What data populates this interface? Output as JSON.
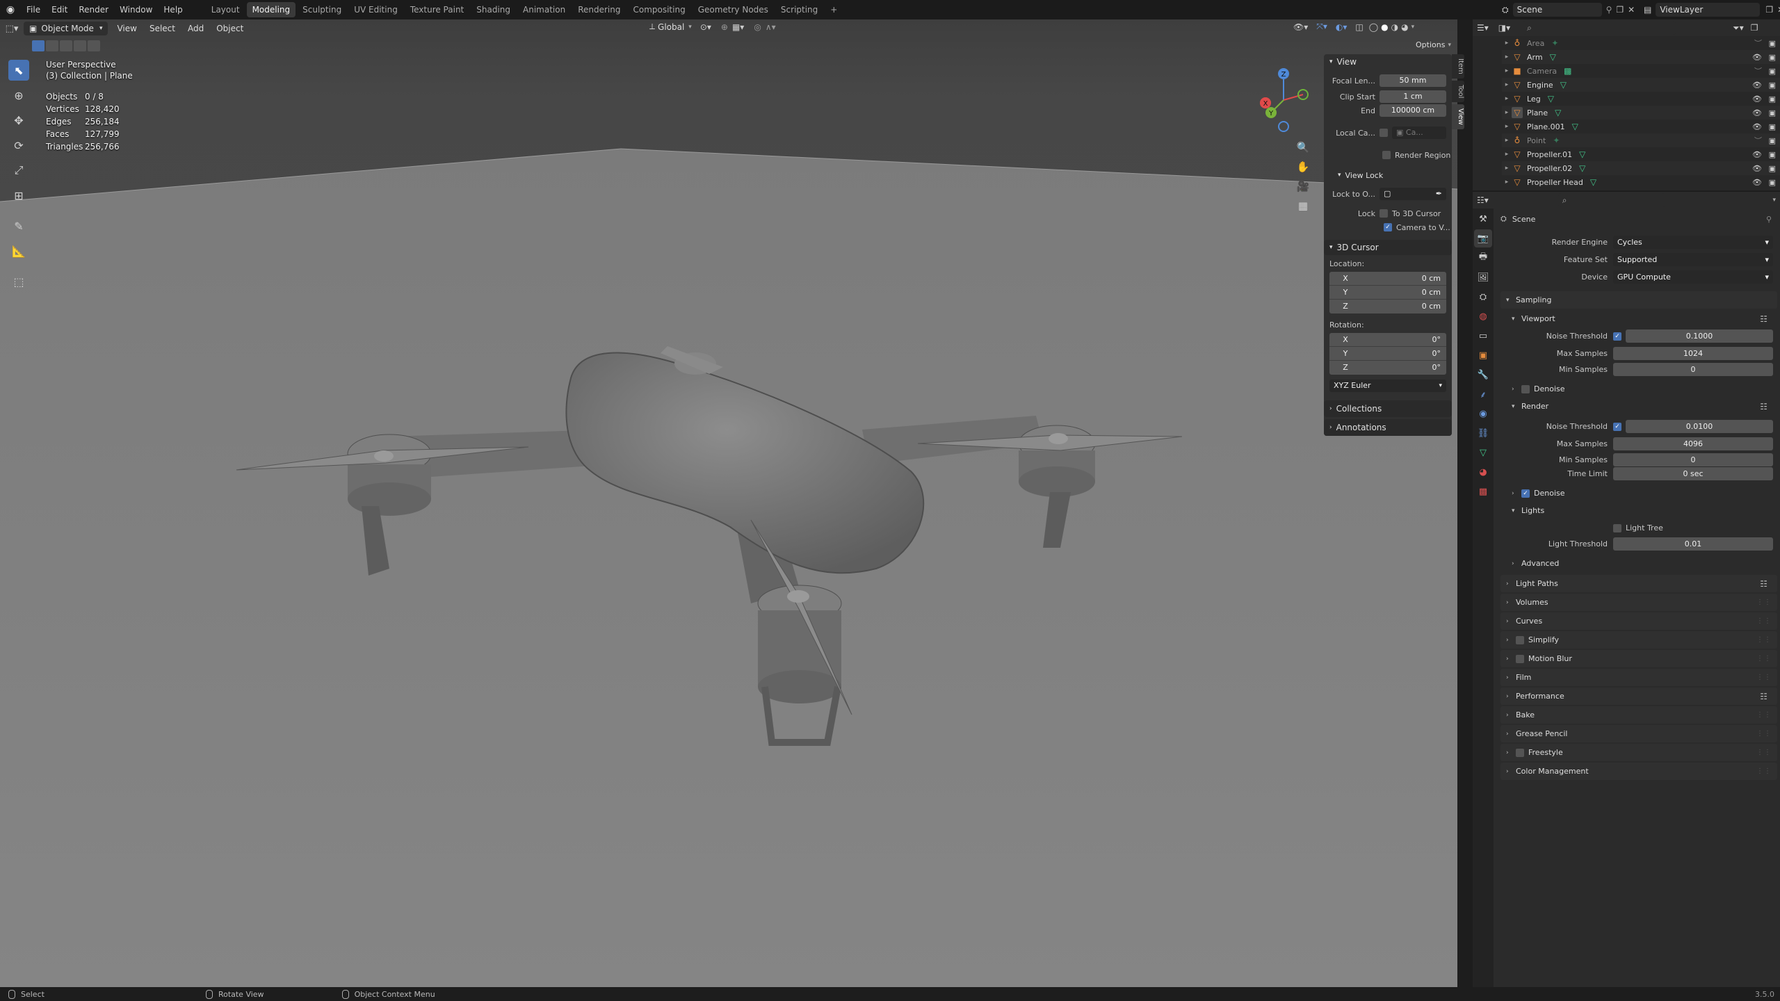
{
  "topbar": {
    "menus": [
      "File",
      "Edit",
      "Render",
      "Window",
      "Help"
    ],
    "workspaces": [
      "Layout",
      "Modeling",
      "Sculpting",
      "UV Editing",
      "Texture Paint",
      "Shading",
      "Animation",
      "Rendering",
      "Compositing",
      "Geometry Nodes",
      "Scripting"
    ],
    "active_workspace": "Modeling",
    "add_tab": "+",
    "scene_name": "Scene",
    "view_layer": "ViewLayer"
  },
  "viewport_header": {
    "mode": "Object Mode",
    "menus": [
      "View",
      "Select",
      "Add",
      "Object"
    ],
    "orientation": "Global",
    "options_label": "Options"
  },
  "viewport": {
    "view_name": "User Perspective",
    "collection": "(3) Collection | Plane",
    "stats": [
      {
        "label": "Objects",
        "value": "0 / 8"
      },
      {
        "label": "Vertices",
        "value": "128,420"
      },
      {
        "label": "Edges",
        "value": "256,184"
      },
      {
        "label": "Faces",
        "value": "127,799"
      },
      {
        "label": "Triangles",
        "value": "256,766"
      }
    ],
    "gizmo_axes": {
      "x": "X",
      "y": "Y",
      "z": "Z"
    }
  },
  "npanel": {
    "tabs": [
      "Item",
      "Tool",
      "View"
    ],
    "active_tab": "View",
    "view_header": "View",
    "focal_length_label": "Focal Len...",
    "focal_length": "50 mm",
    "clip_start_label": "Clip Start",
    "clip_start": "1 cm",
    "clip_end_label": "End",
    "clip_end": "100000 cm",
    "local_camera_label": "Local Ca...",
    "local_camera_value": "Ca...",
    "render_region": "Render Region",
    "view_lock_header": "View Lock",
    "lock_to_object_label": "Lock to O...",
    "lock_label": "Lock",
    "to_3d_cursor": "To 3D Cursor",
    "camera_to_view": "Camera to V...",
    "cursor_header": "3D Cursor",
    "location_label": "Location:",
    "location": [
      {
        "axis": "X",
        "value": "0 cm"
      },
      {
        "axis": "Y",
        "value": "0 cm"
      },
      {
        "axis": "Z",
        "value": "0 cm"
      }
    ],
    "rotation_label": "Rotation:",
    "rotation": [
      {
        "axis": "X",
        "value": "0°"
      },
      {
        "axis": "Y",
        "value": "0°"
      },
      {
        "axis": "Z",
        "value": "0°"
      }
    ],
    "rotation_mode": "XYZ Euler",
    "collections": "Collections",
    "annotations": "Annotations"
  },
  "outliner": {
    "items": [
      {
        "name": "Area",
        "type": "light",
        "dim": true
      },
      {
        "name": "Arm",
        "type": "mesh",
        "dim": false
      },
      {
        "name": "Camera",
        "type": "camera",
        "dim": true
      },
      {
        "name": "Engine",
        "type": "mesh",
        "dim": false
      },
      {
        "name": "Leg",
        "type": "mesh",
        "dim": false
      },
      {
        "name": "Plane",
        "type": "mesh",
        "dim": false
      },
      {
        "name": "Plane.001",
        "type": "mesh",
        "dim": false
      },
      {
        "name": "Point",
        "type": "light",
        "dim": true
      },
      {
        "name": "Propeller.01",
        "type": "mesh",
        "dim": false
      },
      {
        "name": "Propeller.02",
        "type": "mesh",
        "dim": false
      },
      {
        "name": "Propeller Head",
        "type": "mesh",
        "dim": false
      }
    ]
  },
  "properties": {
    "context": "Scene",
    "render_engine_label": "Render Engine",
    "render_engine": "Cycles",
    "feature_set_label": "Feature Set",
    "feature_set": "Supported",
    "device_label": "Device",
    "device": "GPU Compute",
    "sampling": "Sampling",
    "viewport": "Viewport",
    "noise_threshold_label": "Noise Threshold",
    "vp_noise_threshold": "0.1000",
    "max_samples_label": "Max Samples",
    "vp_max_samples": "1024",
    "min_samples_label": "Min Samples",
    "vp_min_samples": "0",
    "denoise": "Denoise",
    "render": "Render",
    "r_noise_threshold": "0.0100",
    "r_max_samples": "4096",
    "r_min_samples": "0",
    "time_limit_label": "Time Limit",
    "r_time_limit": "0 sec",
    "lights": "Lights",
    "light_tree": "Light Tree",
    "light_threshold_label": "Light Threshold",
    "light_threshold": "0.01",
    "advanced": "Advanced",
    "panels": [
      "Light Paths",
      "Volumes",
      "Curves",
      "Simplify",
      "Motion Blur",
      "Film",
      "Performance",
      "Bake",
      "Grease Pencil",
      "Freestyle",
      "Color Management"
    ]
  },
  "statusbar": {
    "select": "Select",
    "rotate": "Rotate View",
    "context_menu": "Object Context Menu",
    "version": "3.5.0"
  },
  "colors": {
    "accent": "#4772b3",
    "object_orange": "#e58c3d",
    "mesh_green": "#43c58a"
  }
}
